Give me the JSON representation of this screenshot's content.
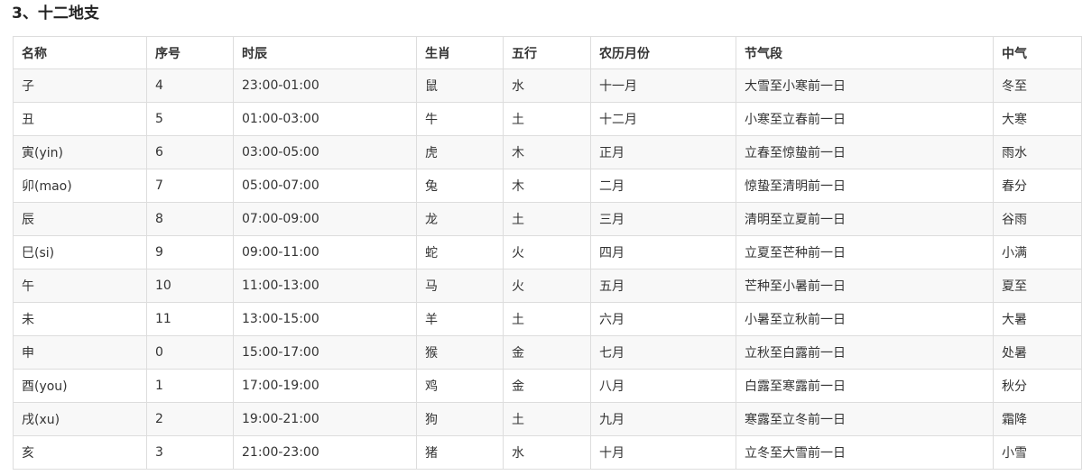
{
  "title": "3、十二地支",
  "table": {
    "headers": [
      "名称",
      "序号",
      "时辰",
      "生肖",
      "五行",
      "农历月份",
      "节气段",
      "中气"
    ],
    "rows": [
      [
        "子",
        "4",
        "23:00-01:00",
        "鼠",
        "水",
        "十一月",
        "大雪至小寒前一日",
        "冬至"
      ],
      [
        "丑",
        "5",
        "01:00-03:00",
        "牛",
        "土",
        "十二月",
        "小寒至立春前一日",
        "大寒"
      ],
      [
        "寅(yin)",
        "6",
        "03:00-05:00",
        "虎",
        "木",
        "正月",
        "立春至惊蛰前一日",
        "雨水"
      ],
      [
        "卯(mao)",
        "7",
        "05:00-07:00",
        "兔",
        "木",
        "二月",
        "惊蛰至清明前一日",
        "春分"
      ],
      [
        "辰",
        "8",
        "07:00-09:00",
        "龙",
        "土",
        "三月",
        "清明至立夏前一日",
        "谷雨"
      ],
      [
        "巳(si)",
        "9",
        "09:00-11:00",
        "蛇",
        "火",
        "四月",
        "立夏至芒种前一日",
        "小满"
      ],
      [
        "午",
        "10",
        "11:00-13:00",
        "马",
        "火",
        "五月",
        "芒种至小暑前一日",
        "夏至"
      ],
      [
        "未",
        "11",
        "13:00-15:00",
        "羊",
        "土",
        "六月",
        "小暑至立秋前一日",
        "大暑"
      ],
      [
        "申",
        "0",
        "15:00-17:00",
        "猴",
        "金",
        "七月",
        "立秋至白露前一日",
        "处暑"
      ],
      [
        "酉(you)",
        "1",
        "17:00-19:00",
        "鸡",
        "金",
        "八月",
        "白露至寒露前一日",
        "秋分"
      ],
      [
        "戌(xu)",
        "2",
        "19:00-21:00",
        "狗",
        "土",
        "九月",
        "寒露至立冬前一日",
        "霜降"
      ],
      [
        "亥",
        "3",
        "21:00-23:00",
        "猪",
        "水",
        "十月",
        "立冬至大雪前一日",
        "小雪"
      ]
    ]
  },
  "colors": {
    "border": "#dddddd",
    "stripe": "#f8f8f8",
    "text": "#333333"
  }
}
